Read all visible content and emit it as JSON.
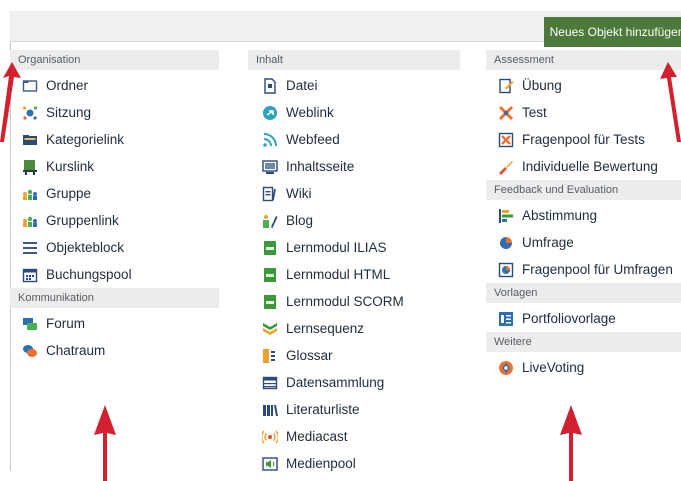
{
  "toolbar": {
    "new_object_label": "Neues Objekt hinzufügen"
  },
  "columns": {
    "col1": {
      "groups": [
        {
          "title": "Organisation",
          "items": [
            {
              "label": "Ordner",
              "icon": "folder-icon"
            },
            {
              "label": "Sitzung",
              "icon": "session-icon"
            },
            {
              "label": "Kategorielink",
              "icon": "category-link-icon"
            },
            {
              "label": "Kurslink",
              "icon": "course-link-icon"
            },
            {
              "label": "Gruppe",
              "icon": "group-icon"
            },
            {
              "label": "Gruppenlink",
              "icon": "group-link-icon"
            },
            {
              "label": "Objekteblock",
              "icon": "item-group-icon"
            },
            {
              "label": "Buchungspool",
              "icon": "calendar-icon"
            }
          ]
        },
        {
          "title": "Kommunikation",
          "items": [
            {
              "label": "Forum",
              "icon": "forum-icon"
            },
            {
              "label": "Chatraum",
              "icon": "chat-icon"
            }
          ]
        }
      ]
    },
    "col2": {
      "groups": [
        {
          "title": "Inhalt",
          "items": [
            {
              "label": "Datei",
              "icon": "file-icon"
            },
            {
              "label": "Weblink",
              "icon": "weblink-icon"
            },
            {
              "label": "Webfeed",
              "icon": "rss-icon"
            },
            {
              "label": "Inhaltsseite",
              "icon": "content-page-icon"
            },
            {
              "label": "Wiki",
              "icon": "wiki-icon"
            },
            {
              "label": "Blog",
              "icon": "blog-icon"
            },
            {
              "label": "Lernmodul ILIAS",
              "icon": "learning-module-icon"
            },
            {
              "label": "Lernmodul HTML",
              "icon": "learning-module-icon"
            },
            {
              "label": "Lernmodul SCORM",
              "icon": "learning-module-icon"
            },
            {
              "label": "Lernsequenz",
              "icon": "learning-sequence-icon"
            },
            {
              "label": "Glossar",
              "icon": "glossary-icon"
            },
            {
              "label": "Datensammlung",
              "icon": "data-collection-icon"
            },
            {
              "label": "Literaturliste",
              "icon": "bibliography-icon"
            },
            {
              "label": "Mediacast",
              "icon": "mediacast-icon"
            },
            {
              "label": "Medienpool",
              "icon": "media-pool-icon"
            }
          ]
        }
      ]
    },
    "col3": {
      "groups": [
        {
          "title": "Assessment",
          "items": [
            {
              "label": "Übung",
              "icon": "exercise-icon"
            },
            {
              "label": "Test",
              "icon": "test-icon"
            },
            {
              "label": "Fragenpool für Tests",
              "icon": "question-pool-icon"
            },
            {
              "label": "Individuelle Bewertung",
              "icon": "assessment-icon"
            }
          ]
        },
        {
          "title": "Feedback und Evaluation",
          "items": [
            {
              "label": "Abstimmung",
              "icon": "poll-icon"
            },
            {
              "label": "Umfrage",
              "icon": "survey-icon"
            },
            {
              "label": "Fragenpool für Umfragen",
              "icon": "survey-pool-icon"
            }
          ]
        },
        {
          "title": "Vorlagen",
          "items": [
            {
              "label": "Portfoliovorlage",
              "icon": "portfolio-template-icon"
            }
          ]
        },
        {
          "title": "Weitere",
          "items": [
            {
              "label": "LiveVoting",
              "icon": "livevoting-icon"
            }
          ]
        }
      ]
    }
  },
  "colors": {
    "accent_button": "#4b7a3a",
    "group_header_bg": "#ececec",
    "annotation_arrow": "#d3202e"
  }
}
